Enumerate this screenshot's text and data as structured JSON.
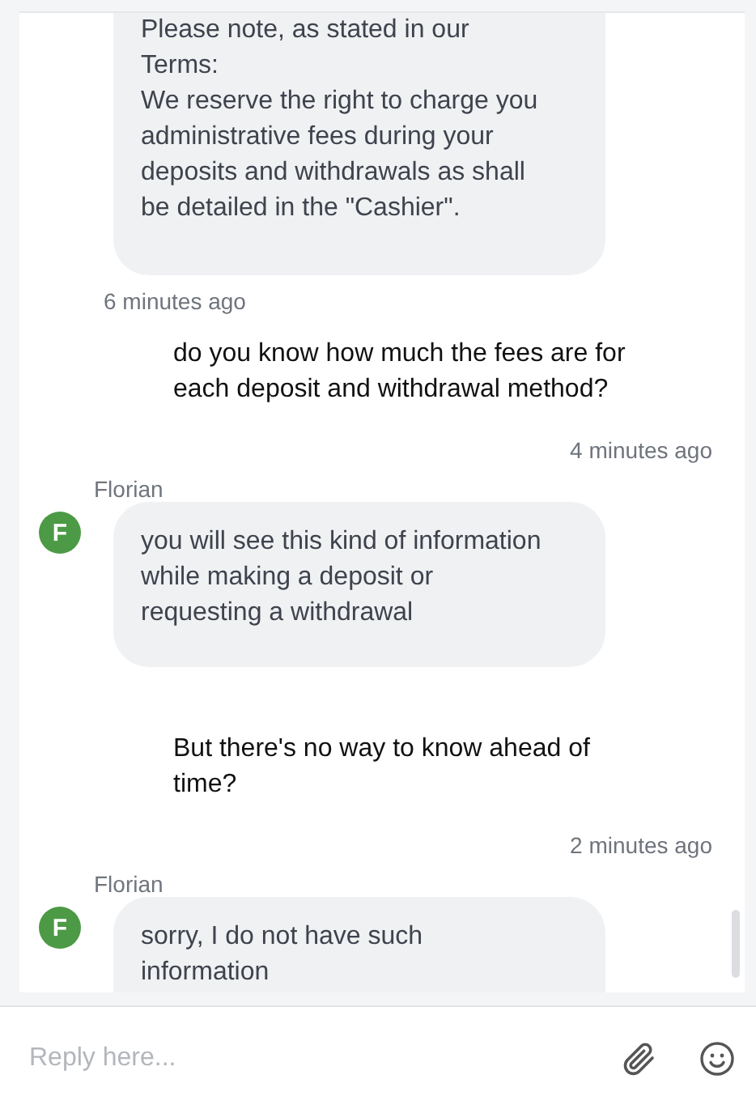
{
  "messages": [
    {
      "kind": "agent",
      "lines": [
        "Please note, as stated in our",
        "Terms:",
        "We reserve the right to charge you",
        "administrative fees during your",
        "deposits and withdrawals as shall",
        "be detailed in the \"Cashier\"."
      ],
      "time": "6 minutes ago"
    },
    {
      "kind": "user",
      "lines": [
        "do you know how much the fees are for",
        "each deposit and withdrawal method?"
      ],
      "time": "4 minutes ago"
    },
    {
      "kind": "agent",
      "sender": "Florian",
      "avatar": "F",
      "lines": [
        "you will see this kind of information",
        "while making a deposit or",
        "requesting a withdrawal"
      ]
    },
    {
      "kind": "user",
      "lines": [
        "But there's no way to know ahead of",
        "time?"
      ],
      "time": "2 minutes ago"
    },
    {
      "kind": "agent",
      "sender": "Florian",
      "avatar": "F",
      "lines": [
        "sorry, I do not have such",
        "information"
      ]
    }
  ],
  "reply": {
    "placeholder": "Reply here..."
  }
}
